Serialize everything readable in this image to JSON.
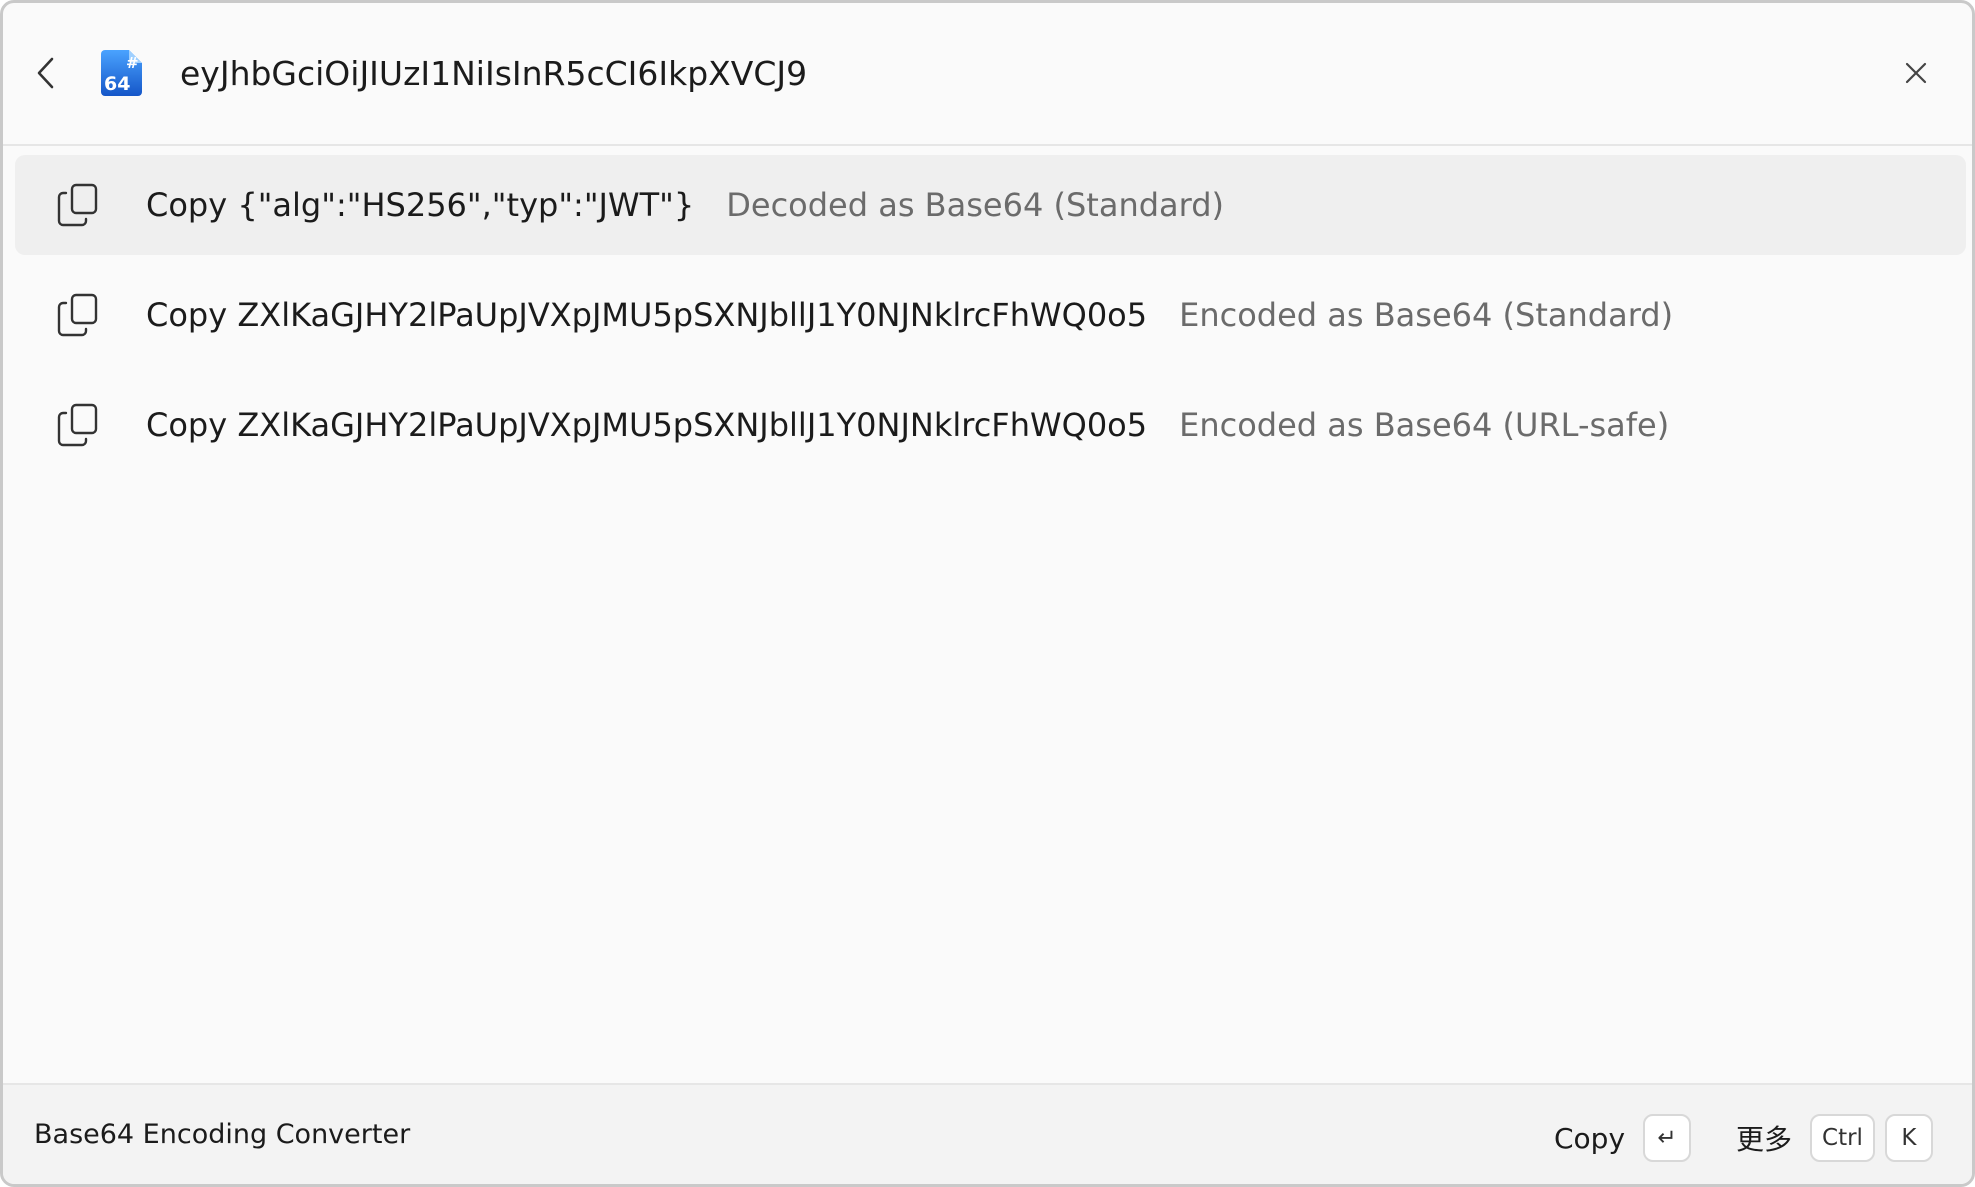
{
  "header": {
    "back_icon": "chevron-left-icon",
    "app_icon_text": "64",
    "app_icon_hash": "#",
    "search_value": "eyJhbGciOiJIUzI1NiIsInR5cCI6IkpXVCJ9",
    "close_icon": "close-icon"
  },
  "results": [
    {
      "icon": "copy-icon",
      "title": "Copy {\"alg\":\"HS256\",\"typ\":\"JWT\"}",
      "subtitle": "Decoded as Base64 (Standard)",
      "selected": true
    },
    {
      "icon": "copy-icon",
      "title": "Copy ZXlKaGJHY2lPaUpJVXpJMU5pSXNJbllJ1Y0NJNklrcFhWQ0o5",
      "subtitle": "Encoded as Base64 (Standard)",
      "selected": false
    },
    {
      "icon": "copy-icon",
      "title": "Copy ZXlKaGJHY2lPaUpJVXpJMU5pSXNJbllJ1Y0NJNklrcFhWQ0o5",
      "subtitle": "Encoded as Base64 (URL-safe)",
      "selected": false
    }
  ],
  "footer": {
    "title": "Base64 Encoding Converter",
    "primary_action_label": "Copy",
    "primary_action_key": "↵",
    "more_label": "更多",
    "more_key_1": "Ctrl",
    "more_key_2": "K"
  },
  "colors": {
    "window_bg": "#fafafa",
    "selected_row_bg": "#efefef",
    "app_icon_blue": "#1f6fe0",
    "subtitle_gray": "#6b6b6b"
  }
}
